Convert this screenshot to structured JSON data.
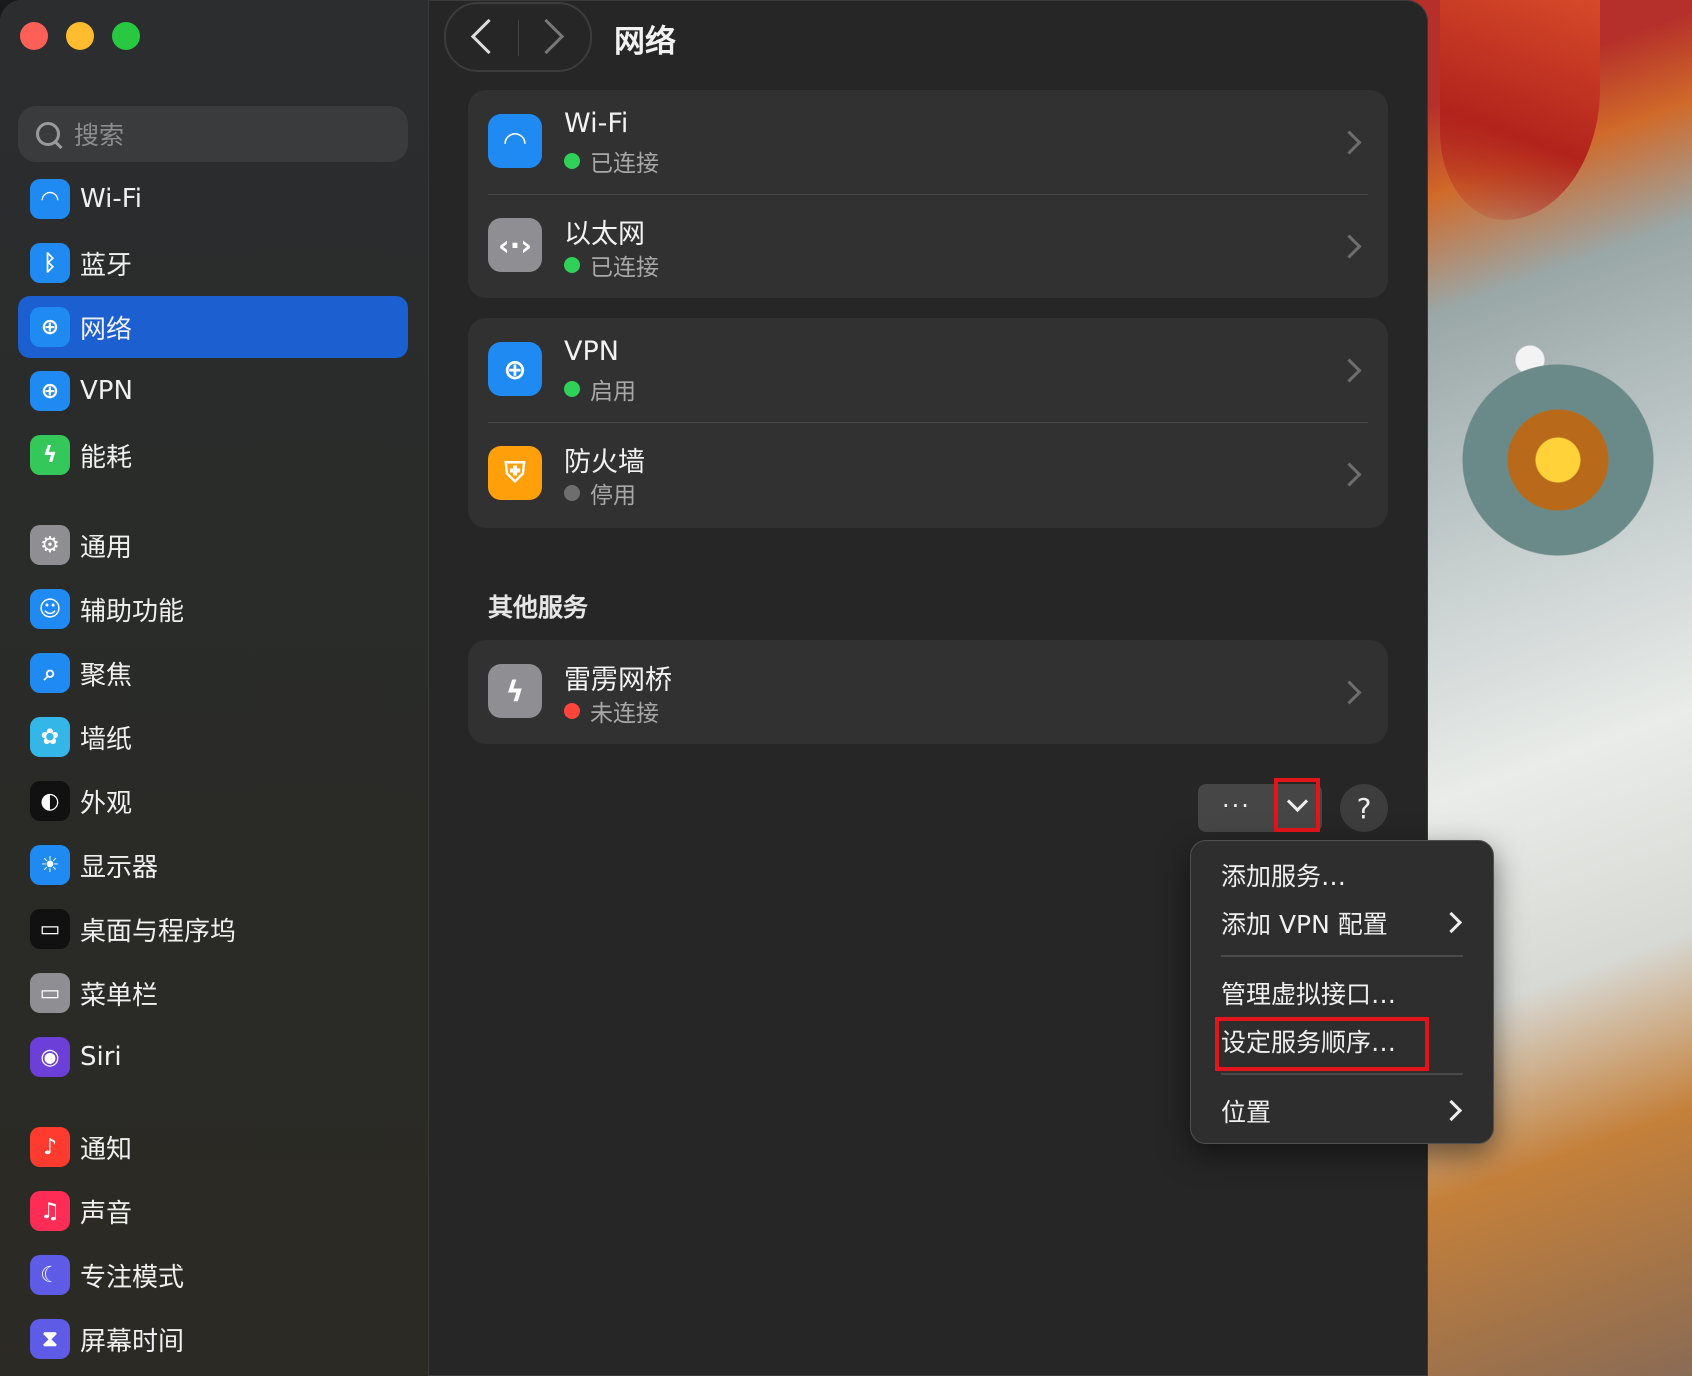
{
  "window": {
    "title": "网络",
    "search": {
      "placeholder": "搜索"
    }
  },
  "sidebar": {
    "items": [
      {
        "label": "Wi-Fi",
        "icon": "wifi-icon",
        "color": "#1f8af2"
      },
      {
        "label": "蓝牙",
        "icon": "bluetooth-icon",
        "color": "#1f8af2"
      },
      {
        "label": "网络",
        "icon": "globe-icon",
        "color": "#1f8af2",
        "active": true
      },
      {
        "label": "VPN",
        "icon": "vpn-globe-icon",
        "color": "#1f8af2"
      },
      {
        "label": "能耗",
        "icon": "battery-bolt-icon",
        "color": "#34c759"
      },
      {
        "label": "通用",
        "icon": "gear-icon",
        "color": "#8e8e93"
      },
      {
        "label": "辅助功能",
        "icon": "accessibility-icon",
        "color": "#1f8af2"
      },
      {
        "label": "聚焦",
        "icon": "spotlight-icon",
        "color": "#1f8af2"
      },
      {
        "label": "墙纸",
        "icon": "wallpaper-flower-icon",
        "color": "#35b6e8"
      },
      {
        "label": "外观",
        "icon": "appearance-icon",
        "color": "#111111"
      },
      {
        "label": "显示器",
        "icon": "display-sun-icon",
        "color": "#1f8af2"
      },
      {
        "label": "桌面与程序坞",
        "icon": "dock-icon",
        "color": "#111111"
      },
      {
        "label": "菜单栏",
        "icon": "menubar-icon",
        "color": "#8e8e93"
      },
      {
        "label": "Siri",
        "icon": "siri-icon",
        "color": "#6b3fd8"
      },
      {
        "label": "通知",
        "icon": "bell-icon",
        "color": "#ff3b30"
      },
      {
        "label": "声音",
        "icon": "speaker-icon",
        "color": "#ff2d55"
      },
      {
        "label": "专注模式",
        "icon": "moon-icon",
        "color": "#5e5ce6"
      },
      {
        "label": "屏幕时间",
        "icon": "hourglass-icon",
        "color": "#5e5ce6"
      }
    ]
  },
  "main": {
    "groups": [
      [
        {
          "title": "Wi-Fi",
          "status": "已连接",
          "status_color": "#30d158",
          "icon": "wifi-icon",
          "icon_color": "#1f8af2"
        },
        {
          "title": "以太网",
          "status": "已连接",
          "status_color": "#30d158",
          "icon": "ethernet-icon",
          "icon_color": "#8e8e93"
        }
      ],
      [
        {
          "title": "VPN",
          "status": "启用",
          "status_color": "#30d158",
          "icon": "vpn-globe-icon",
          "icon_color": "#1f8af2"
        },
        {
          "title": "防火墙",
          "status": "停用",
          "status_color": "#6e6e6e",
          "icon": "firewall-shield-icon",
          "icon_color": "#ff9f0a"
        }
      ]
    ],
    "other_services_title": "其他服务",
    "other_services": [
      {
        "title": "雷雳网桥",
        "status": "未连接",
        "status_color": "#ff453a",
        "icon": "thunderbolt-icon",
        "icon_color": "#8e8e93"
      }
    ],
    "more_label": "···",
    "help_label": "?"
  },
  "menu": {
    "items": [
      {
        "label": "添加服务…"
      },
      {
        "label": "添加 VPN 配置",
        "submenu": true
      },
      {
        "label": "管理虚拟接口…"
      },
      {
        "label": "设定服务顺序…",
        "highlighted": true
      },
      {
        "label": "位置",
        "submenu": true
      }
    ]
  },
  "annotation_color": "#e3151b"
}
